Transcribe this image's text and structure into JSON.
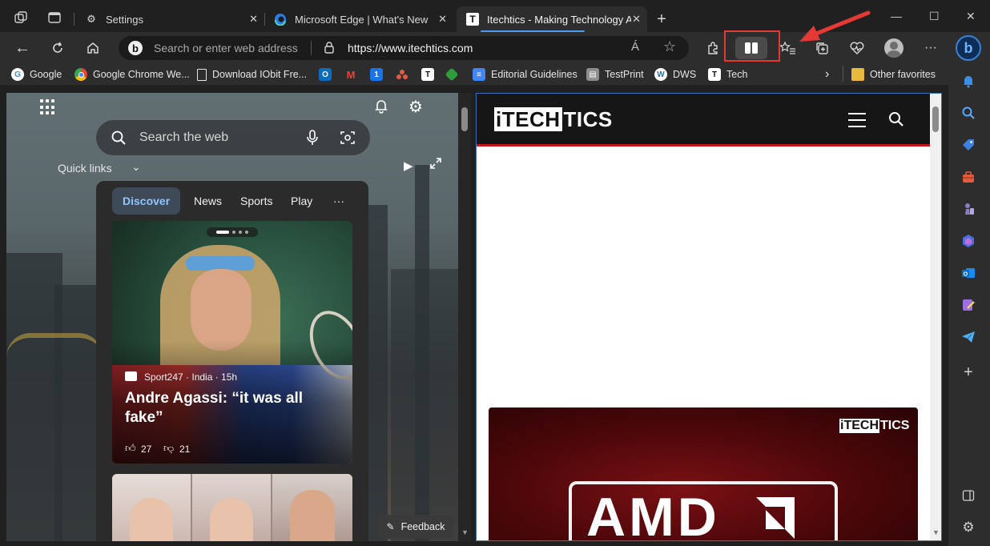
{
  "tabs": [
    {
      "label": "Settings",
      "icon": "gear-icon"
    },
    {
      "label": "Microsoft Edge | What's New",
      "icon": "edge-icon"
    },
    {
      "label": "Itechtics - Making Technology Ac",
      "icon": "itechtics-icon",
      "active": true
    }
  ],
  "address": {
    "placeholder": "Search or enter web address",
    "url": "https://www.itechtics.com"
  },
  "toolbar": {
    "read_aloud": "Á",
    "more": "···"
  },
  "favorites": {
    "items": [
      {
        "label": "Google",
        "icon": "G",
        "color": "#ffffff"
      },
      {
        "label": "Google Chrome We...",
        "icon": "chrome",
        "color": "#4caf50"
      },
      {
        "label": "Download IObit Fre...",
        "icon": "doc",
        "color": "#ffffff"
      },
      {
        "label": "",
        "icon": "O",
        "color": "#0f6cbd"
      },
      {
        "label": "",
        "icon": "M",
        "color": "#ea4335"
      },
      {
        "label": "",
        "icon": "1",
        "color": "#1a73e8"
      },
      {
        "label": "",
        "icon": "dots",
        "color": "#e25b45"
      },
      {
        "label": "",
        "icon": "T",
        "color": "#ffffff"
      },
      {
        "label": "",
        "icon": "arrow",
        "color": "#2e9d3a"
      },
      {
        "label": "Editorial Guidelines",
        "icon": "doc",
        "color": "#4285f4"
      },
      {
        "label": "TestPrint",
        "icon": "printer",
        "color": "#bbbbbb"
      },
      {
        "label": "DWS",
        "icon": "W",
        "color": "#ffffff"
      },
      {
        "label": "Tech",
        "icon": "T",
        "color": "#ffffff"
      }
    ],
    "other": "Other favorites"
  },
  "newtab": {
    "search_placeholder": "Search the web",
    "quick_links": "Quick links",
    "feed_tabs": [
      "Discover",
      "News",
      "Sports",
      "Play",
      "···"
    ],
    "card": {
      "source": "Sport247 · India · 15h",
      "title": "Andre Agassi: “it was all fake”",
      "likes": "27",
      "dislikes": "21"
    },
    "feedback": "Feedback"
  },
  "site": {
    "logo_prefix": "iTECH",
    "logo_suffix": "TICS",
    "promo_logo_prefix": "iTECH",
    "promo_logo_suffix": "TICS",
    "promo_brand": "AMD"
  },
  "colors": {
    "accent": "#4a9cf0",
    "highlight": "#e53935",
    "site_red": "#c2181b"
  }
}
